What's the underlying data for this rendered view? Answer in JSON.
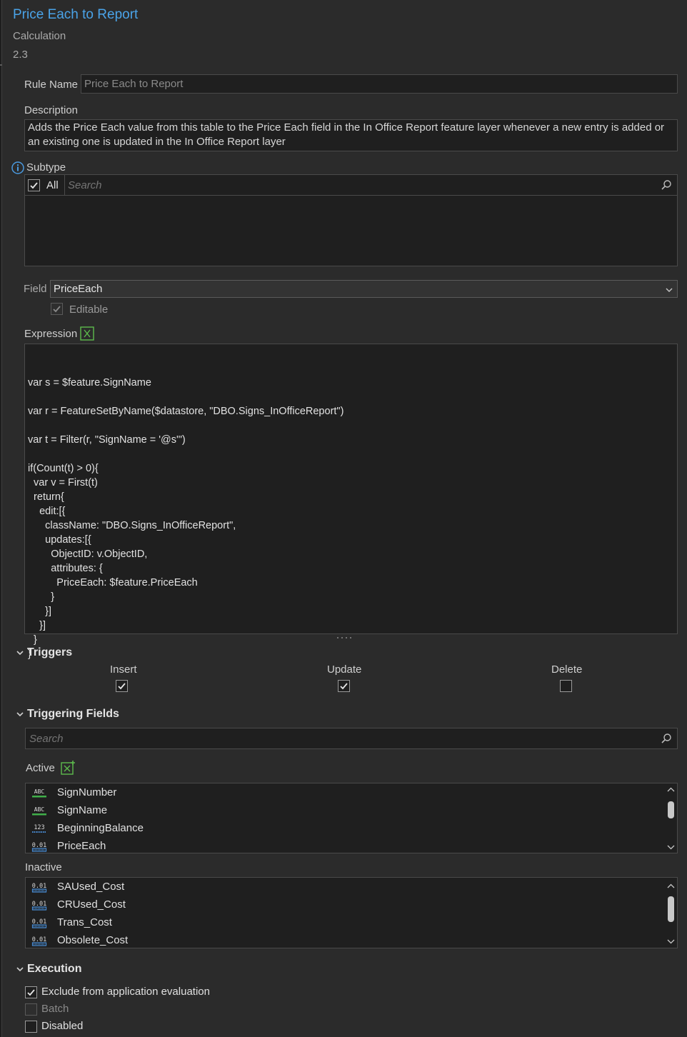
{
  "header": {
    "title": "Price Each to Report",
    "rule_type": "Calculation",
    "version": "2.3"
  },
  "rule_name": {
    "label": "Rule Name",
    "value": "Price Each to Report"
  },
  "description": {
    "label": "Description",
    "value": "Adds the Price Each value from this table to the Price Each field in the In Office Report feature layer whenever a new entry is added or an existing one is updated in the In Office Report layer"
  },
  "subtype": {
    "label": "Subtype",
    "all_label": "All",
    "all_checked": true,
    "search_placeholder": "Search"
  },
  "field": {
    "label": "Field",
    "selected": "PriceEach",
    "editable_label": "Editable",
    "editable_checked": true
  },
  "expression": {
    "label": "Expression",
    "lines": [
      "var s = $feature.SignName",
      "",
      "var r = FeatureSetByName($datastore, \"DBO.Signs_InOfficeReport\")",
      "",
      "var t = Filter(r, \"SignName = '@s'\")",
      "",
      "if(Count(t) > 0){",
      "  var v = First(t)",
      "  return{",
      "    edit:[{",
      "      className: \"DBO.Signs_InOfficeReport\",",
      "      updates:[{",
      "        ObjectID: v.ObjectID,",
      "        attributes: {",
      "          PriceEach: $feature.PriceEach",
      "        }",
      "      }]",
      "    }]",
      "  }",
      "}"
    ]
  },
  "triggers": {
    "heading": "Triggers",
    "insert_label": "Insert",
    "insert_checked": true,
    "update_label": "Update",
    "update_checked": true,
    "delete_label": "Delete",
    "delete_checked": false
  },
  "triggering_fields": {
    "heading": "Triggering Fields",
    "search_placeholder": "Search",
    "active_label": "Active",
    "active_items": [
      {
        "icon": "text-field-icon",
        "icon_text": "ABC",
        "name": "SignNumber"
      },
      {
        "icon": "text-field-icon",
        "icon_text": "ABC",
        "name": "SignName"
      },
      {
        "icon": "integer-field-icon",
        "icon_text": "123",
        "name": "BeginningBalance"
      },
      {
        "icon": "double-field-icon",
        "icon_text": "0.01",
        "name": "PriceEach"
      }
    ],
    "inactive_label": "Inactive",
    "inactive_items": [
      {
        "icon": "double-field-icon",
        "icon_text": "0.01",
        "name": "SAUsed_Cost"
      },
      {
        "icon": "double-field-icon",
        "icon_text": "0.01",
        "name": "CRUsed_Cost"
      },
      {
        "icon": "double-field-icon",
        "icon_text": "0.01",
        "name": "Trans_Cost"
      },
      {
        "icon": "double-field-icon",
        "icon_text": "0.01",
        "name": "Obsolete_Cost"
      }
    ]
  },
  "execution": {
    "heading": "Execution",
    "exclude_label": "Exclude from application evaluation",
    "exclude_checked": true,
    "batch_label": "Batch",
    "batch_checked": false,
    "disabled_label": "Disabled",
    "disabled_checked": false
  },
  "colors": {
    "title": "#4aa3e8",
    "background": "#2b2b2b",
    "field_bg": "#1f1f1f",
    "text_icon_green": "#3fae49",
    "number_icon_blue": "#4a8fd9",
    "expression_icon_green": "#5dbb4c"
  }
}
